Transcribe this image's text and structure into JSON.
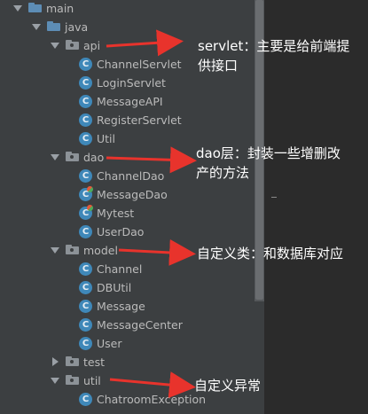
{
  "tree": {
    "rows": [
      {
        "name": "main",
        "kind": "folder-blue",
        "expanded": true,
        "level": 0
      },
      {
        "name": "java",
        "kind": "folder-blue",
        "expanded": true,
        "level": 1
      },
      {
        "name": "api",
        "kind": "folder-gray",
        "expanded": true,
        "level": 2
      },
      {
        "name": "ChannelServlet",
        "kind": "class",
        "level": 3
      },
      {
        "name": "LoginServlet",
        "kind": "class",
        "level": 3
      },
      {
        "name": "MessageAPI",
        "kind": "class",
        "level": 3
      },
      {
        "name": "RegisterServlet",
        "kind": "class",
        "level": 3
      },
      {
        "name": "Util",
        "kind": "class",
        "level": 3
      },
      {
        "name": "dao",
        "kind": "folder-gray",
        "expanded": true,
        "level": 2
      },
      {
        "name": "ChannelDao",
        "kind": "class",
        "level": 3
      },
      {
        "name": "MessageDao",
        "kind": "class-badge",
        "level": 3
      },
      {
        "name": "Mytest",
        "kind": "class-badge",
        "level": 3
      },
      {
        "name": "UserDao",
        "kind": "class",
        "level": 3
      },
      {
        "name": "model",
        "kind": "folder-gray",
        "expanded": true,
        "level": 2
      },
      {
        "name": "Channel",
        "kind": "class",
        "level": 3
      },
      {
        "name": "DBUtil",
        "kind": "class",
        "level": 3
      },
      {
        "name": "Message",
        "kind": "class",
        "level": 3
      },
      {
        "name": "MessageCenter",
        "kind": "class",
        "level": 3
      },
      {
        "name": "User",
        "kind": "class",
        "level": 3
      },
      {
        "name": "test",
        "kind": "folder-gray",
        "expanded": false,
        "level": 2
      },
      {
        "name": "util",
        "kind": "folder-gray",
        "expanded": true,
        "level": 2
      },
      {
        "name": "ChatroomException",
        "kind": "class",
        "level": 3
      }
    ]
  },
  "annotations": {
    "api_note_line1": "servlet：主要是给前端提",
    "api_note_line2": "供接口",
    "dao_note_line1": "dao层：封装一些增删改",
    "dao_note_line2": "产的方法",
    "model_note": "自定义类：和数据库对应",
    "util_note": "自定义异常"
  },
  "colors": {
    "panel_bg": "#3c3f41",
    "editor_bg": "#2b2b2b",
    "text": "#bbbbbb",
    "arrow_red": "#e8332c",
    "folder_blue": "#5d8db5",
    "class_icon": "#3f88b9"
  },
  "icons": {
    "folder": "folder-icon",
    "class": "class-c-icon",
    "expand": "chevron-down-icon",
    "collapse": "chevron-right-icon"
  }
}
